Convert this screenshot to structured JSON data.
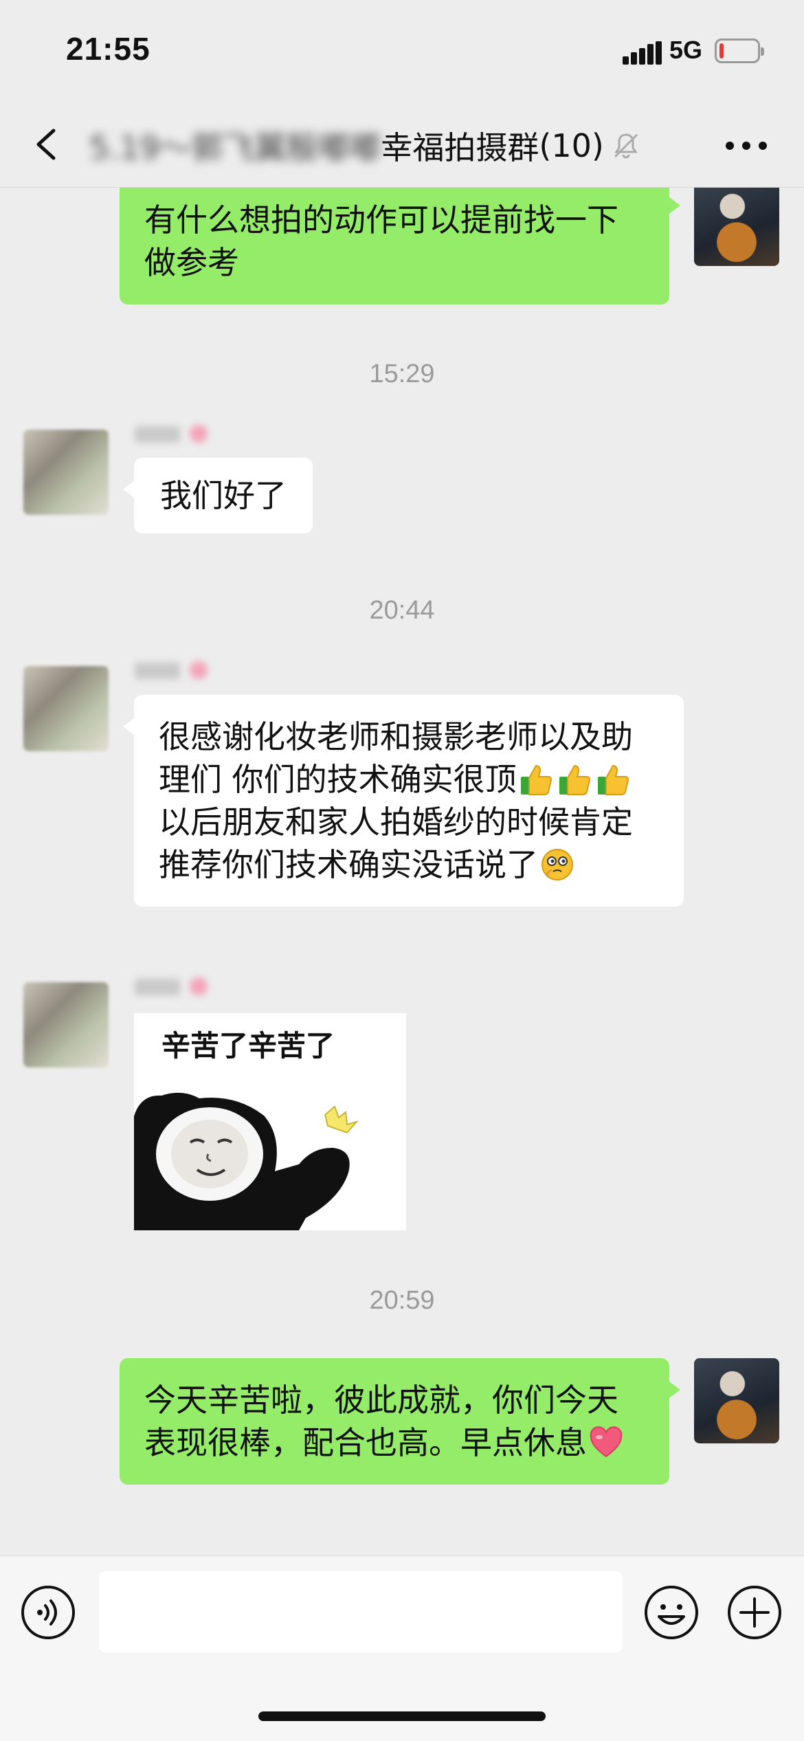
{
  "status_bar": {
    "time": "21:55",
    "network": "5G",
    "battery_level": 0.12
  },
  "nav": {
    "title_blurred": "5.19～郭飞翼殷嘟嘟",
    "title": "幸福拍摄群",
    "member_count": "(10)",
    "icons": {
      "back": "chevron-left-icon",
      "mute": "bell-muted-icon",
      "more": "more-dots-icon"
    }
  },
  "messages": {
    "m1": "有什么想拍的动作可以提前找一下做参考",
    "ts1": "15:29",
    "m2": "我们好了",
    "ts2": "20:44",
    "m3_part1": "很感谢化妆老师和摄影老师以及助理们 你们的技术确实很顶",
    "m3_part2": "以后朋友和家人拍婚纱的时候肯定推荐你们技术确实没话说了",
    "sticker_text": "辛苦了辛苦了",
    "ts3": "20:59",
    "m5_text": "今天辛苦啦，彼此成就，你们今天表现很棒，配合也高。早点休息"
  },
  "emojis": {
    "thumbs_up": "thumbs-up-icon",
    "thinking": "thinking-face-icon",
    "heart": "heart-icon"
  },
  "input_bar": {
    "placeholder": "",
    "icons": {
      "voice": "voice-icon",
      "emoji": "emoji-icon",
      "plus": "plus-icon"
    }
  },
  "colors": {
    "bubble_self": "#95ec69",
    "bubble_other": "#ffffff",
    "background": "#ededed",
    "timestamp": "#9a9a9a"
  }
}
